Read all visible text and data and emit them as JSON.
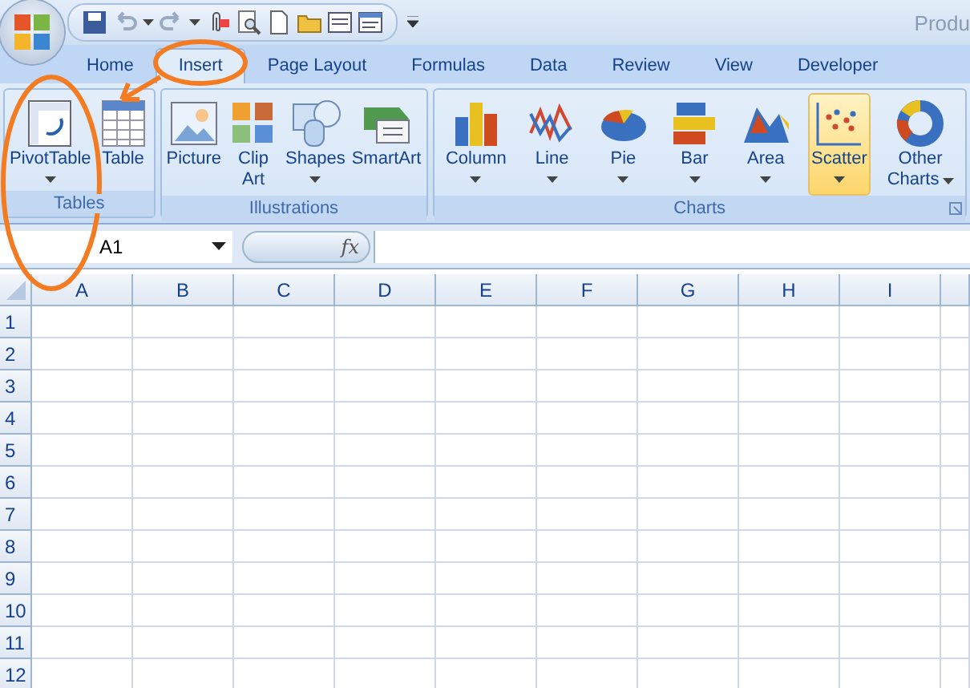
{
  "window": {
    "title": "Produ"
  },
  "tabs": [
    {
      "label": "Home",
      "selected": false
    },
    {
      "label": "Insert",
      "selected": true
    },
    {
      "label": "Page Layout",
      "selected": false
    },
    {
      "label": "Formulas",
      "selected": false
    },
    {
      "label": "Data",
      "selected": false
    },
    {
      "label": "Review",
      "selected": false
    },
    {
      "label": "View",
      "selected": false
    },
    {
      "label": "Developer",
      "selected": false
    }
  ],
  "ribbon_groups": [
    {
      "label": "Tables",
      "items": [
        {
          "lines": [
            "PivotTable"
          ],
          "dropdown": true,
          "selected": false
        },
        {
          "lines": [
            "Table"
          ],
          "dropdown": false,
          "selected": false
        }
      ]
    },
    {
      "label": "Illustrations",
      "items": [
        {
          "lines": [
            "Picture"
          ],
          "dropdown": false,
          "selected": false
        },
        {
          "lines": [
            "Clip",
            "Art"
          ],
          "dropdown": false,
          "selected": false
        },
        {
          "lines": [
            "Shapes"
          ],
          "dropdown": true,
          "selected": false
        },
        {
          "lines": [
            "SmartArt"
          ],
          "dropdown": false,
          "selected": false
        }
      ]
    },
    {
      "label": "Charts",
      "items": [
        {
          "lines": [
            "Column"
          ],
          "dropdown": true,
          "selected": false
        },
        {
          "lines": [
            "Line"
          ],
          "dropdown": true,
          "selected": false
        },
        {
          "lines": [
            "Pie"
          ],
          "dropdown": true,
          "selected": false
        },
        {
          "lines": [
            "Bar"
          ],
          "dropdown": true,
          "selected": false
        },
        {
          "lines": [
            "Area"
          ],
          "dropdown": true,
          "selected": false
        },
        {
          "lines": [
            "Scatter"
          ],
          "dropdown": true,
          "selected": true
        },
        {
          "lines": [
            "Other",
            "Charts"
          ],
          "dropdown": true,
          "selected": false
        }
      ]
    }
  ],
  "formula_bar": {
    "name_box": "A1",
    "function_label": "fx"
  },
  "sheet": {
    "columns": [
      "A",
      "B",
      "C",
      "D",
      "E",
      "F",
      "G",
      "H",
      "I"
    ],
    "rows": [
      "1",
      "2",
      "3",
      "4",
      "5",
      "6",
      "7",
      "8",
      "9",
      "10",
      "11",
      "12"
    ]
  }
}
